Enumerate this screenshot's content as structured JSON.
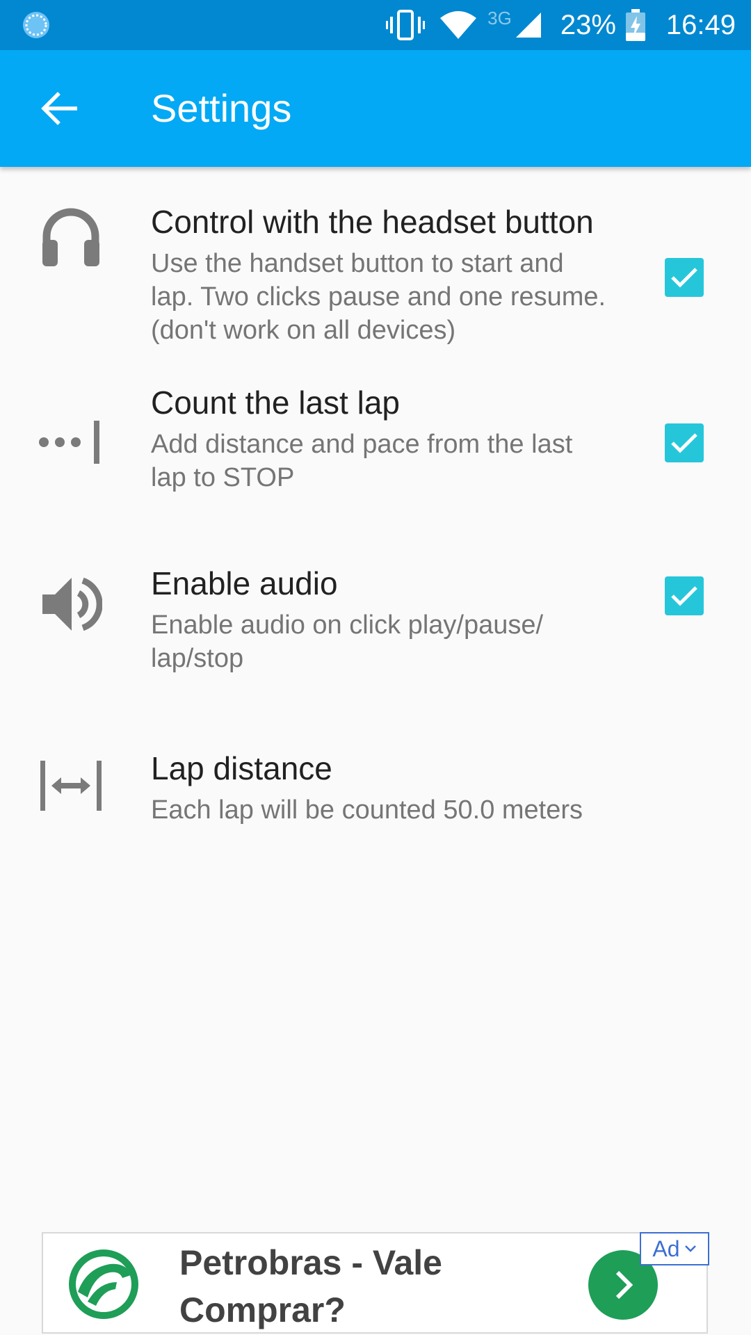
{
  "status_bar": {
    "network_type": "3G",
    "battery_percent": "23%",
    "time": "16:49"
  },
  "app_bar": {
    "title": "Settings"
  },
  "settings": [
    {
      "title": "Control with the headset button",
      "summary": "Use the handset button to start and lap. Two clicks pause and one resume. (don't work on all devices)",
      "icon": "headset-icon",
      "checked": true
    },
    {
      "title": "Count the last lap",
      "summary": "Add distance and pace from the last lap to STOP",
      "icon": "last-lap-icon",
      "checked": true
    },
    {
      "title": "Enable audio",
      "summary": "Enable audio on click play/pause/ lap/stop",
      "icon": "volume-icon",
      "checked": true
    },
    {
      "title": "Lap distance",
      "summary": "Each lap will be counted 50.0 meters",
      "icon": "lap-distance-icon"
    }
  ],
  "ad": {
    "title_line1": "Petrobras - Vale",
    "title_line2": "Comprar?",
    "badge": "Ad"
  },
  "colors": {
    "status_bar": "#0288d1",
    "app_bar": "#03a9f4",
    "checkbox": "#26c6da",
    "ad_button": "#1e9e57"
  }
}
